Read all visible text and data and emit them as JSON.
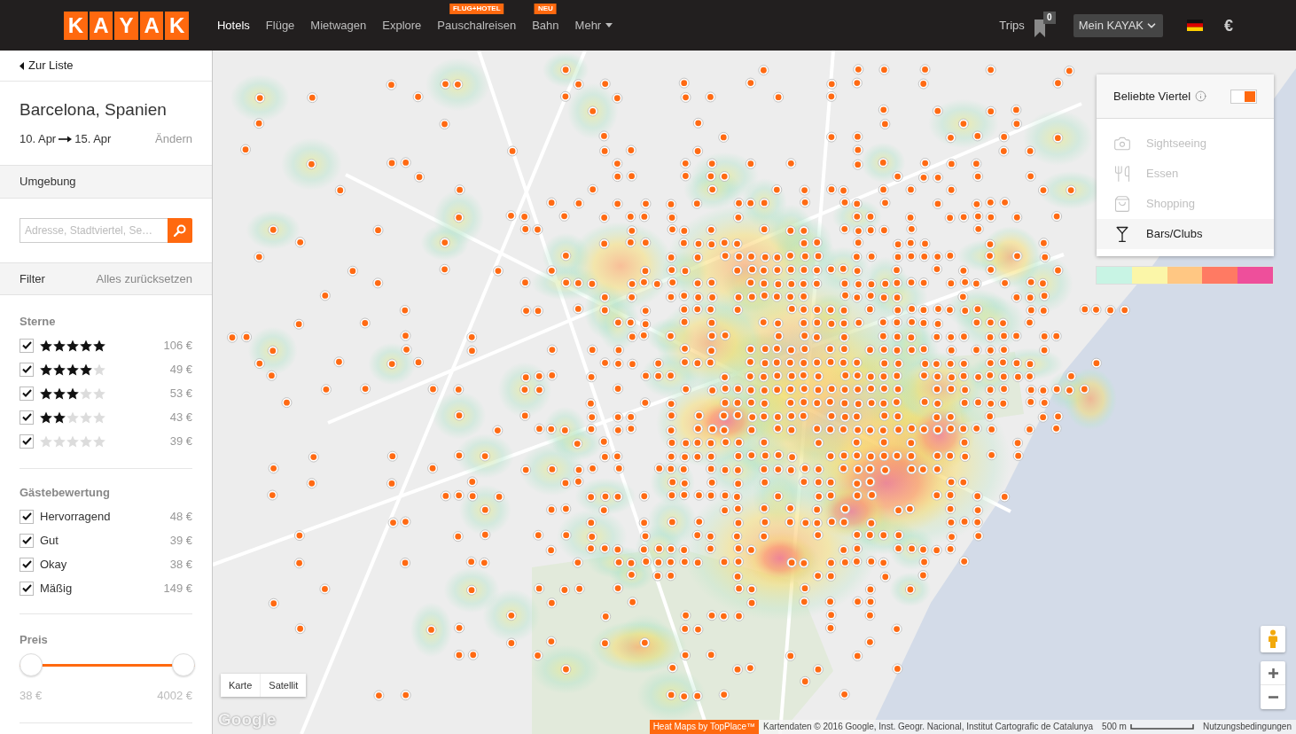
{
  "header": {
    "logo": [
      "K",
      "A",
      "Y",
      "A",
      "K"
    ],
    "nav": [
      {
        "label": "Hotels",
        "selected": true,
        "kind": "link"
      },
      {
        "label": "Flüge",
        "selected": false,
        "kind": "link"
      },
      {
        "label": "Mietwagen",
        "selected": false,
        "kind": "link"
      },
      {
        "label": "Explore",
        "selected": false,
        "kind": "link"
      },
      {
        "label": "Pauschalreisen",
        "selected": false,
        "kind": "link",
        "badge": "FLUG+HOTEL"
      },
      {
        "label": "Bahn",
        "selected": false,
        "kind": "link",
        "badge": "NEU"
      },
      {
        "label": "Mehr",
        "selected": false,
        "kind": "menu"
      }
    ],
    "trips": {
      "label": "Trips",
      "count": "0"
    },
    "account": "Mein KAYAK",
    "currency": "€"
  },
  "sidebar": {
    "back": "Zur Liste",
    "destination": "Barcelona, Spanien",
    "date_from": "10. Apr",
    "date_to": "15. Apr",
    "change": "Ändern",
    "nearby": {
      "title": "Umgebung",
      "placeholder": "Adresse, Stadtviertel, Se…"
    },
    "filter": {
      "title": "Filter",
      "reset": "Alles zurücksetzen"
    },
    "stars": {
      "title": "Sterne",
      "rows": [
        {
          "checked": true,
          "stars": 5,
          "price": "106 €"
        },
        {
          "checked": true,
          "stars": 4,
          "price": "49 €"
        },
        {
          "checked": true,
          "stars": 3,
          "price": "53 €"
        },
        {
          "checked": true,
          "stars": 2,
          "price": "43 €"
        },
        {
          "checked": true,
          "stars": 0,
          "price": "39 €"
        }
      ]
    },
    "guest_rating": {
      "title": "Gästebewertung",
      "rows": [
        {
          "checked": true,
          "label": "Hervorragend",
          "price": "48 €"
        },
        {
          "checked": true,
          "label": "Gut",
          "price": "39 €"
        },
        {
          "checked": true,
          "label": "Okay",
          "price": "38 €"
        },
        {
          "checked": true,
          "label": "Mäßig",
          "price": "149 €"
        }
      ]
    },
    "price": {
      "title": "Preis",
      "level": 1,
      "min": "38 €",
      "max": "4002 €"
    }
  },
  "map": {
    "neighborhoods": {
      "title": "Beliebte Viertel",
      "on": true,
      "categories": [
        {
          "label": "Sightseeing",
          "selected": false
        },
        {
          "label": "Essen",
          "selected": false
        },
        {
          "label": "Shopping",
          "selected": false
        },
        {
          "label": "Bars/Clubs",
          "selected": true
        }
      ]
    },
    "legend": [
      {
        "color": "#c8f4e4"
      },
      {
        "color": "#fbf6a8"
      },
      {
        "color": "#ffc783"
      },
      {
        "color": "#ff7a63"
      },
      {
        "color": "#ee4f9b"
      }
    ],
    "map_types": [
      "Karte",
      "Satellit"
    ],
    "logo": "Google",
    "footer": {
      "heatmap_credit": "Heat Maps by TopPlace™",
      "attribution": "Kartendaten © 2016 Google, Inst. Geogr. Nacional, Institut Cartografic de Catalunya",
      "scale": "500 m",
      "terms": "Nutzungsbedingungen"
    }
  }
}
